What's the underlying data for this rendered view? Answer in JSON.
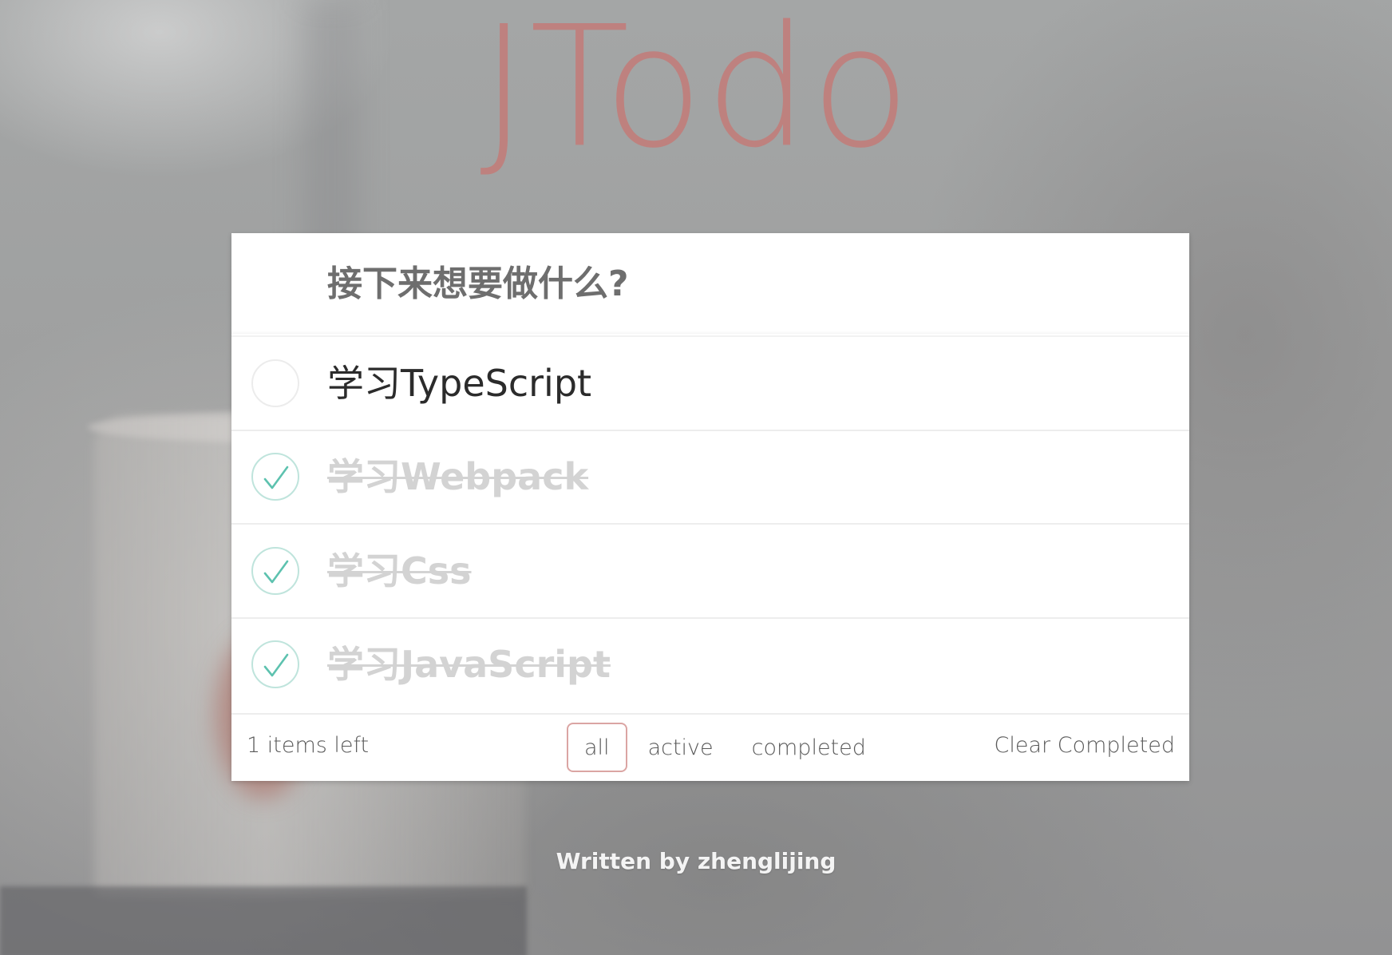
{
  "header": {
    "title": "JTodo"
  },
  "new_todo": {
    "placeholder": "接下来想要做什么?"
  },
  "todos": [
    {
      "label": "学习TypeScript",
      "completed": false
    },
    {
      "label": "学习Webpack",
      "completed": true
    },
    {
      "label": "学习Css",
      "completed": true
    },
    {
      "label": "学习JavaScript",
      "completed": true
    }
  ],
  "footer": {
    "items_left": "1 items left",
    "filters": {
      "all": "all",
      "active": "active",
      "completed": "completed"
    },
    "selected_filter": "all",
    "clear_label": "Clear Completed"
  },
  "credit": "Written by zhenglijing",
  "colors": {
    "title": "#c0807d",
    "check": "#5dc2af",
    "check_border": "#bfe4dc",
    "filter_selected_border": "#dba5a3",
    "completed_text": "#d3d3d3"
  },
  "icons": {
    "toggle_done": "checkmark-icon",
    "toggle_open": "empty-circle-icon"
  }
}
